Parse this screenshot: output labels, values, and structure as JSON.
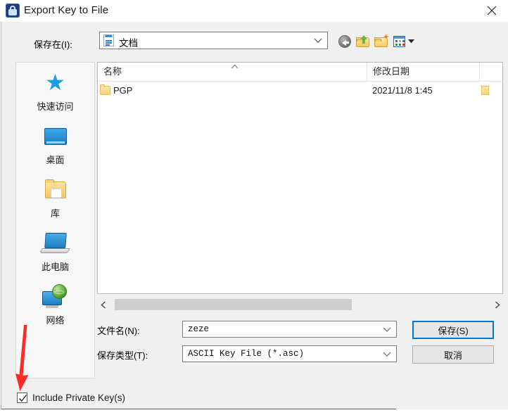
{
  "window": {
    "title": "Export Key to File",
    "title_icon": "lock-icon",
    "close_label": "✕"
  },
  "toolbar": {
    "save_in_label": "保存在(I):",
    "location_value": "文档",
    "location_icon": "documents-icon",
    "buttons": [
      {
        "name": "back-button",
        "icon": "back-arrow-icon"
      },
      {
        "name": "up-one-level-button",
        "icon": "up-folder-icon"
      },
      {
        "name": "new-folder-button",
        "icon": "new-folder-icon"
      },
      {
        "name": "views-button",
        "icon": "views-icon"
      }
    ]
  },
  "places": {
    "items": [
      {
        "label": "快速访问",
        "icon": "star-icon",
        "name": "sidebar-item-quick-access"
      },
      {
        "label": "桌面",
        "icon": "desktop-icon",
        "name": "sidebar-item-desktop"
      },
      {
        "label": "库",
        "icon": "library-folder-icon",
        "name": "sidebar-item-libraries"
      },
      {
        "label": "此电脑",
        "icon": "computer-icon",
        "name": "sidebar-item-this-pc"
      },
      {
        "label": "网络",
        "icon": "network-icon",
        "name": "sidebar-item-network"
      }
    ]
  },
  "file_list": {
    "columns": [
      {
        "label": "名称",
        "name": "column-header-name"
      },
      {
        "label": "修改日期",
        "name": "column-header-date-modified"
      },
      {
        "label": "",
        "name": "column-header-type"
      }
    ],
    "sort_indicator": "ascending",
    "rows": [
      {
        "name": "PGP",
        "date_modified": "2021/11/8 1:45",
        "type": "",
        "icon": "folder-icon"
      }
    ],
    "scrollbar": {
      "orientation": "horizontal",
      "thumb_fraction": 0.62
    }
  },
  "form": {
    "filename_label": "文件名(N):",
    "filename_value": "zeze",
    "filetype_label": "保存类型(T):",
    "filetype_value": "ASCII Key File (*.asc)"
  },
  "buttons": {
    "save": "保存(S)",
    "cancel": "取消"
  },
  "options": {
    "include_private_keys_label": "Include Private Key(s)",
    "include_private_keys_checked": true
  },
  "annotation": {
    "arrow_color": "#fb2b25",
    "points_to": "include-private-keys-checkbox"
  },
  "colors": {
    "accent": "#0078d7",
    "dialog_bg": "#f0f0f0",
    "list_bg": "#ffffff",
    "folder_yellow": "#f6d479"
  }
}
